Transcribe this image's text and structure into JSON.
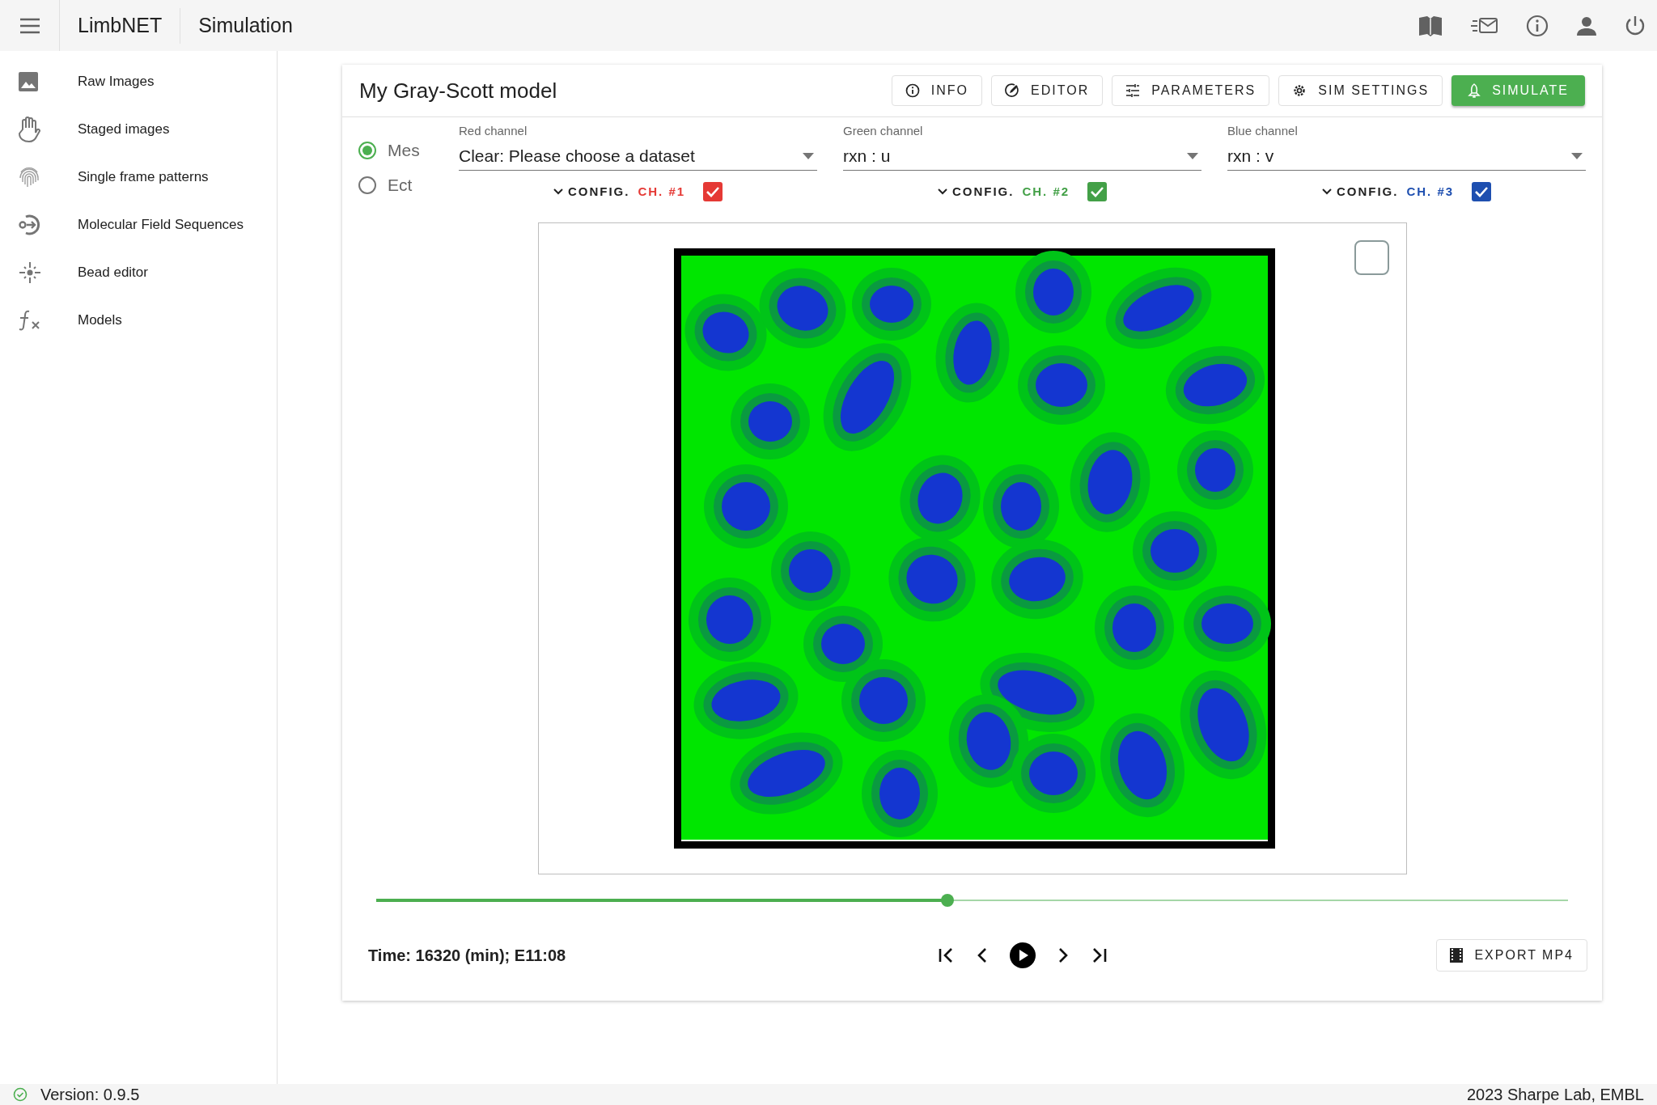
{
  "app_bar": {
    "brand": "LimbNET",
    "title": "Simulation"
  },
  "sidebar": {
    "items": [
      {
        "label": "Raw Images"
      },
      {
        "label": "Staged images"
      },
      {
        "label": "Single frame patterns"
      },
      {
        "label": "Molecular Field Sequences"
      },
      {
        "label": "Bead editor"
      },
      {
        "label": "Models"
      }
    ]
  },
  "card": {
    "title": "My Gray-Scott model",
    "buttons": [
      {
        "label": "INFO",
        "kind": "outlined"
      },
      {
        "label": "EDITOR",
        "kind": "outlined"
      },
      {
        "label": "PARAMETERS",
        "kind": "outlined"
      },
      {
        "label": "SIM SETTINGS",
        "kind": "outlined"
      },
      {
        "label": "SIMULATE",
        "kind": "primary"
      }
    ],
    "radios": [
      {
        "label": "Mes",
        "selected": true
      },
      {
        "label": "Ect",
        "selected": false
      }
    ],
    "channels": [
      {
        "label": "Red channel",
        "value": "Clear: Please choose a dataset",
        "config": "CONFIG.",
        "channel": "CH. #1",
        "color": "#e53935",
        "checked": true
      },
      {
        "label": "Green channel",
        "value": "rxn : u",
        "config": "CONFIG.",
        "channel": "CH. #2",
        "color": "#43a047",
        "checked": true
      },
      {
        "label": "Blue channel",
        "value": "rxn : v",
        "config": "CONFIG.",
        "channel": "CH. #3",
        "color": "#1e4fb0",
        "checked": true
      }
    ],
    "overlay_checkbox": {
      "checked": false
    },
    "timeline": {
      "level": 0.479
    },
    "time": "Time: 16320 (min); E11:08",
    "export_button": "EXPORT MP4"
  },
  "status_bar": {
    "version": "Version: 0.9.5",
    "credit": "2023 Sharpe Lab, EMBL"
  }
}
